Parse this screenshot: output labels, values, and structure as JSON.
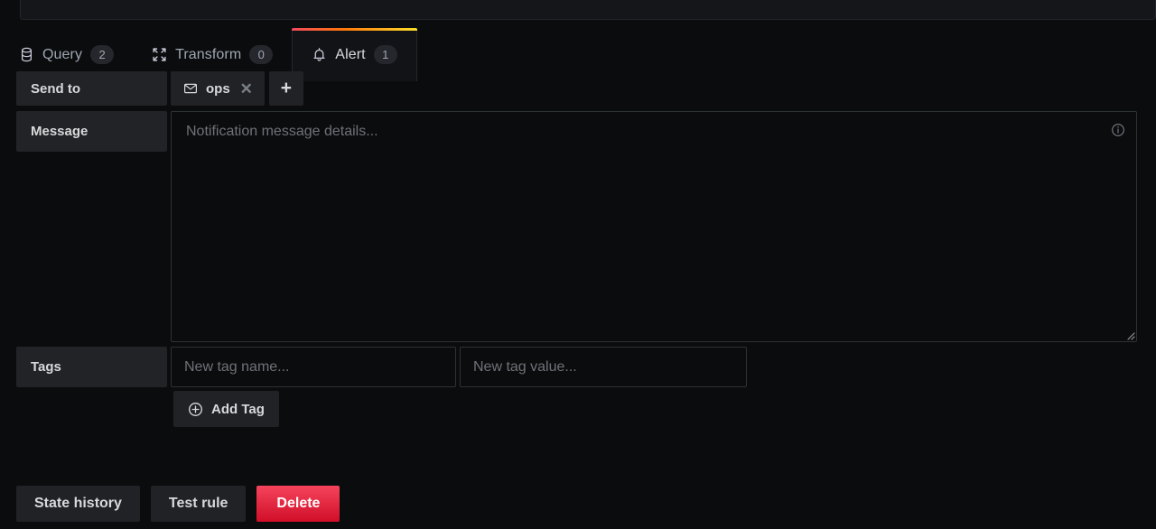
{
  "panel": {
    "tabs": [
      {
        "id": "query",
        "label": "Query",
        "badge": "2",
        "icon": "database-icon",
        "active": false
      },
      {
        "id": "transform",
        "label": "Transform",
        "badge": "0",
        "icon": "transform-icon",
        "active": false
      },
      {
        "id": "alert",
        "label": "Alert",
        "badge": "1",
        "icon": "bell-icon",
        "active": true
      }
    ],
    "active_tab_accent_start": "#f2495c",
    "active_tab_accent_mid": "#ff780a",
    "active_tab_accent_end": "#fade2a"
  },
  "alert_form": {
    "send_to": {
      "label": "Send to",
      "channels": [
        {
          "name": "ops",
          "icon": "mail-icon",
          "remove_icon": "close-icon"
        }
      ],
      "add_label": "+"
    },
    "message": {
      "label": "Message",
      "placeholder": "Notification message details...",
      "value": "",
      "info_icon": "info-circle-icon",
      "resize_icon": "resize-handle-icon"
    },
    "tags": {
      "label": "Tags",
      "name_placeholder": "New tag name...",
      "name_value": "",
      "value_placeholder": "New tag value...",
      "value_value": "",
      "add_tag_label": "Add Tag",
      "add_tag_icon": "circle-plus-icon"
    }
  },
  "footer": {
    "state_history_label": "State history",
    "test_rule_label": "Test rule",
    "delete_label": "Delete",
    "delete_color": "#d10e28"
  }
}
